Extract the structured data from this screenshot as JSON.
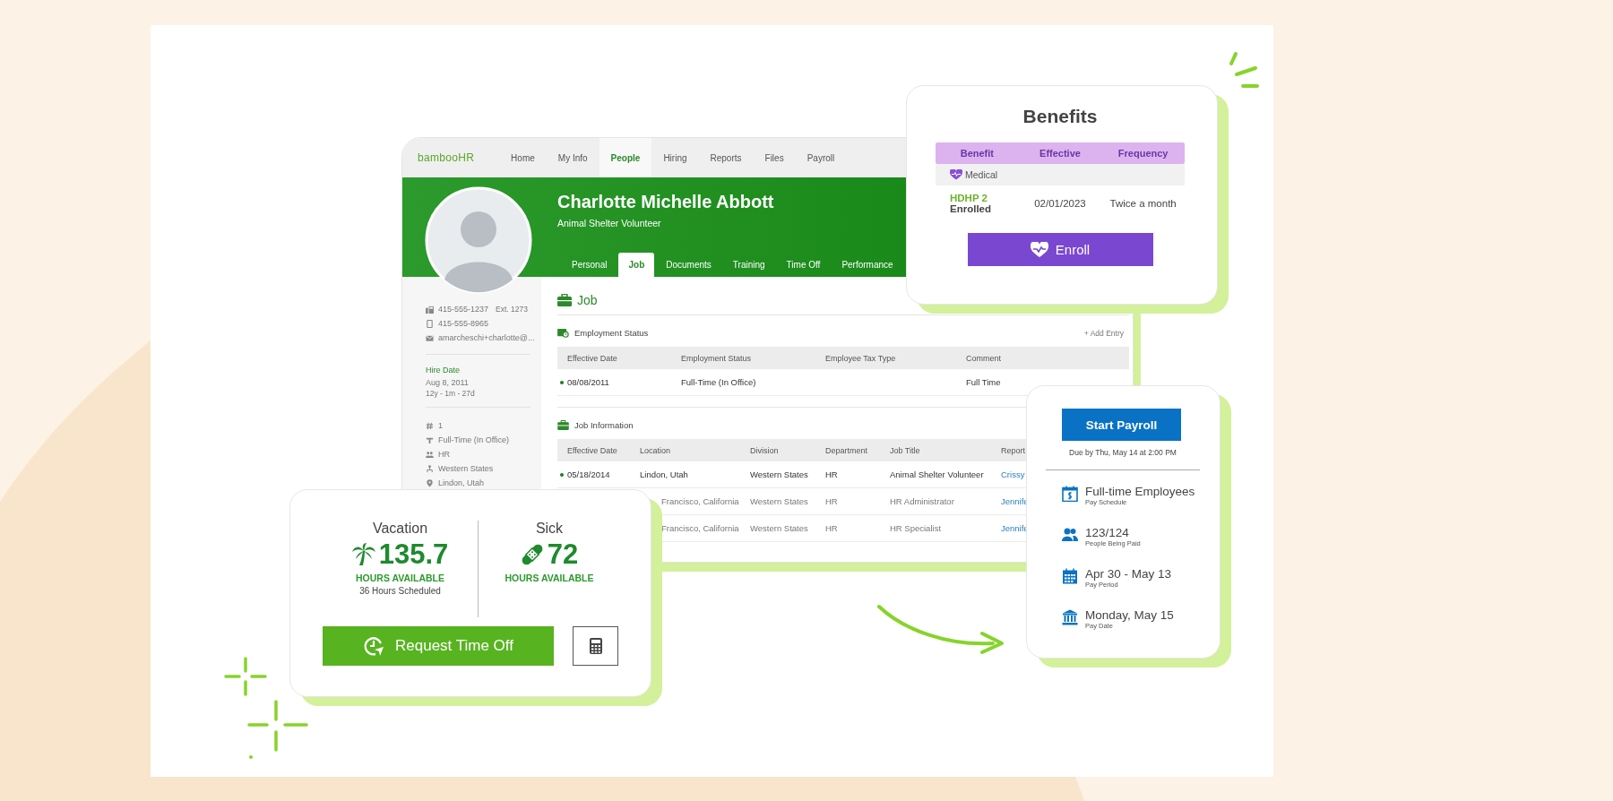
{
  "app_window": {
    "logo": "bambooHR",
    "nav": [
      {
        "label": "Home",
        "selected": false
      },
      {
        "label": "My Info",
        "selected": false
      },
      {
        "label": "People",
        "selected": true
      },
      {
        "label": "Hiring",
        "selected": false
      },
      {
        "label": "Reports",
        "selected": false
      },
      {
        "label": "Files",
        "selected": false
      },
      {
        "label": "Payroll",
        "selected": false
      }
    ],
    "profile": {
      "name": "Charlotte Michelle Abbott",
      "title": "Animal Shelter Volunteer"
    },
    "tabs": [
      {
        "label": "Personal",
        "selected": false
      },
      {
        "label": "Job",
        "selected": true
      },
      {
        "label": "Documents",
        "selected": false
      },
      {
        "label": "Training",
        "selected": false
      },
      {
        "label": "Time Off",
        "selected": false
      },
      {
        "label": "Performance",
        "selected": false
      }
    ],
    "sidebar": {
      "contacts": [
        {
          "kind": "phone",
          "text": "415-555-1237",
          "extension": "Ext. 1273"
        },
        {
          "kind": "mobile",
          "text": "415-555-8965"
        },
        {
          "kind": "email",
          "text": "amarcheschi+charlotte@..."
        }
      ],
      "hire_date": {
        "label": "Hire Date",
        "date": "Aug 8, 2011",
        "tenure": "12y - 1m - 27d"
      },
      "details": [
        {
          "kind": "number",
          "text": "1"
        },
        {
          "kind": "status",
          "text": "Full-Time (In Office)"
        },
        {
          "kind": "department",
          "text": "HR"
        },
        {
          "kind": "division",
          "text": "Western States"
        },
        {
          "kind": "location",
          "text": "Lindon, Utah"
        }
      ]
    },
    "section_title": "Job",
    "employment_status": {
      "title": "Employment Status",
      "action": "+ Add Entry",
      "columns": [
        "Effective Date",
        "Employment Status",
        "Employee Tax Type",
        "Comment"
      ],
      "rows": [
        {
          "current": true,
          "effective_date": "08/08/2011",
          "status": "Full-Time (In Office)",
          "comment": "Full Time"
        }
      ]
    },
    "job_information": {
      "title": "Job Information",
      "columns": [
        "Effective Date",
        "Location",
        "Division",
        "Department",
        "Job Title",
        "Report"
      ],
      "rows": [
        {
          "current": true,
          "effective_date": "05/18/2014",
          "location": "Lindon, Utah",
          "division": "Western States",
          "department": "HR",
          "job_title": "Animal Shelter Volunteer",
          "report": "Crissy"
        },
        {
          "current": false,
          "location": "Francisco, California",
          "division": "Western States",
          "department": "HR",
          "job_title": "HR Administrator",
          "report": "Jennife"
        },
        {
          "current": false,
          "location": "Francisco, California",
          "division": "Western States",
          "department": "HR",
          "job_title": "HR Specialist",
          "report": "Jennife"
        }
      ]
    }
  },
  "benefits": {
    "title": "Benefits",
    "columns": [
      "Benefit",
      "Effective",
      "Frequency"
    ],
    "group": "Medical",
    "rows": [
      {
        "plan": "HDHP 2",
        "status": "Enrolled",
        "effective": "02/01/2023",
        "frequency": "Twice a month"
      }
    ],
    "button": "Enroll"
  },
  "time_off": {
    "balances": [
      {
        "kind": "vacation",
        "title": "Vacation",
        "hours": "135.7",
        "caption": "HOURS AVAILABLE",
        "note": "36 Hours Scheduled"
      },
      {
        "kind": "sick",
        "title": "Sick",
        "hours": "72",
        "caption": "HOURS AVAILABLE"
      }
    ],
    "button": "Request Time Off"
  },
  "payroll": {
    "button": "Start Payroll",
    "due": "Due by Thu, May 14 at 2:00 PM",
    "items": [
      {
        "kind": "schedule",
        "value": "Full-time Employees",
        "label": "Pay Schedule"
      },
      {
        "kind": "people",
        "value": "123/124",
        "label": "People Being Paid"
      },
      {
        "kind": "period",
        "value": "Apr 30 - May 13",
        "label": "Pay Period"
      },
      {
        "kind": "date",
        "value": "Monday, May 15",
        "label": "Pay Date"
      }
    ]
  }
}
